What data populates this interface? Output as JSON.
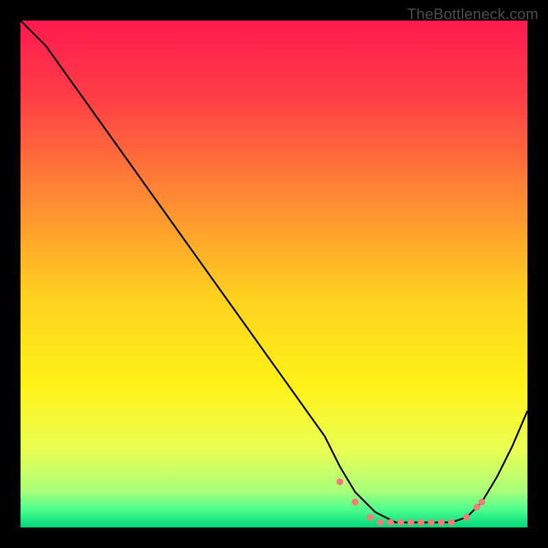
{
  "watermark": "TheBottleneck.com",
  "chart_data": {
    "type": "line",
    "title": "",
    "xlabel": "",
    "ylabel": "",
    "xlim": [
      0,
      100
    ],
    "ylim": [
      0,
      100
    ],
    "grid": false,
    "notes": "Chart has no visible axis ticks, tick labels, or legend. Background is a vertical gradient (red→orange→yellow→light-green→green). Primary curve is black with a short initial shallow segment then a near-linear steep descent to a flat bottom trough then a rise. A second series of salmon/pink dots overlays the trough region.",
    "series": [
      {
        "name": "curve",
        "type": "line",
        "color": "#000000",
        "x": [
          0,
          5,
          10,
          15,
          20,
          25,
          30,
          35,
          40,
          45,
          50,
          55,
          60,
          63,
          66,
          70,
          74,
          78,
          82,
          85,
          88,
          91,
          94,
          97,
          100
        ],
        "y": [
          100,
          95,
          88,
          81,
          74,
          67,
          60,
          53,
          46,
          39,
          32,
          25,
          18,
          12,
          7,
          3,
          1,
          1,
          1,
          1,
          2,
          5,
          10,
          16,
          23
        ]
      },
      {
        "name": "dots",
        "type": "scatter",
        "color": "#f37b78",
        "x": [
          63,
          66,
          69,
          71,
          73,
          75,
          77,
          79,
          81,
          83,
          85,
          88,
          90,
          91
        ],
        "y": [
          9,
          5,
          2,
          1,
          1,
          1,
          1,
          1,
          1,
          1,
          1,
          2,
          4,
          5
        ]
      }
    ],
    "background_gradient_stops": [
      {
        "offset": 0.0,
        "color": "#ff1a4e"
      },
      {
        "offset": 0.15,
        "color": "#ff3d46"
      },
      {
        "offset": 0.35,
        "color": "#ff8a33"
      },
      {
        "offset": 0.55,
        "color": "#ffd21f"
      },
      {
        "offset": 0.72,
        "color": "#fff218"
      },
      {
        "offset": 0.85,
        "color": "#e8ff55"
      },
      {
        "offset": 0.93,
        "color": "#a6ff7a"
      },
      {
        "offset": 0.965,
        "color": "#4bff8d"
      },
      {
        "offset": 1.0,
        "color": "#00d67a"
      }
    ]
  }
}
